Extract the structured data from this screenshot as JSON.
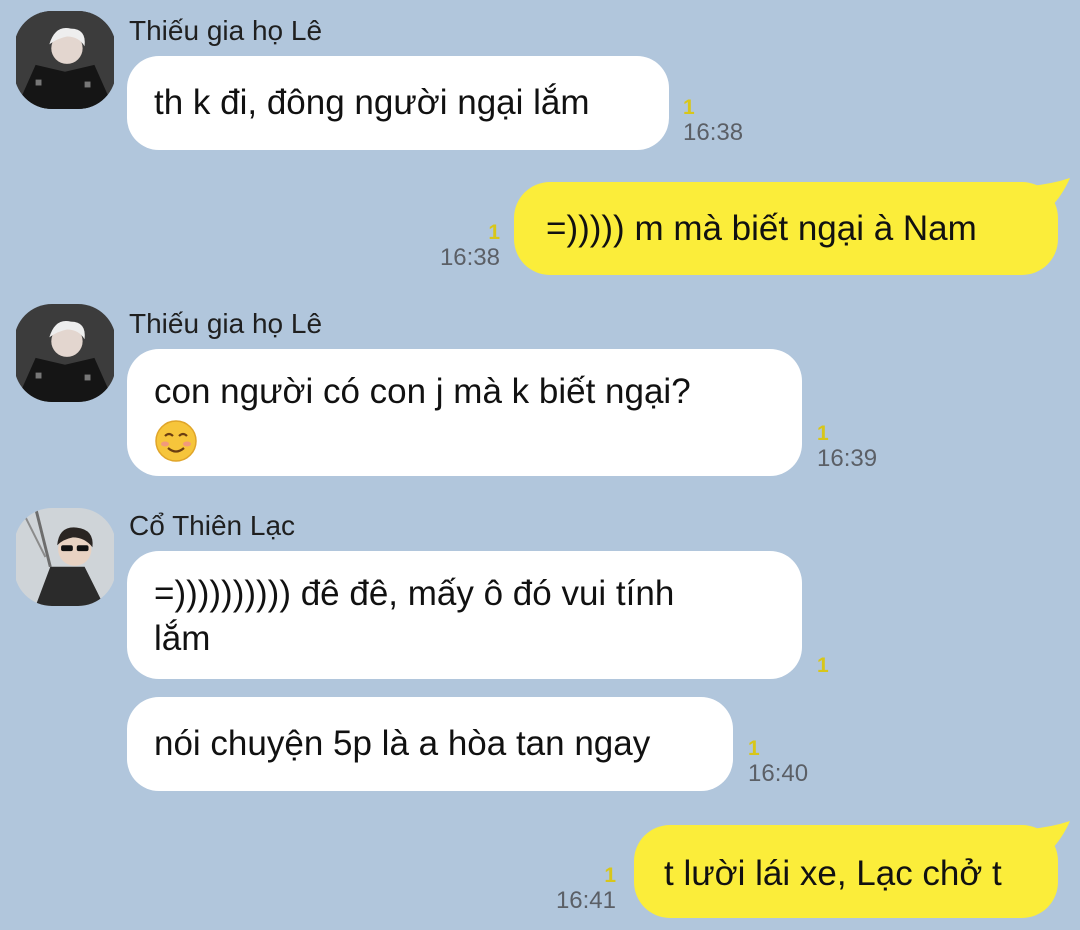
{
  "messages": [
    {
      "sender": "Thiếu gia họ Lê",
      "text": "th k đi, đông người ngại lắm",
      "read": "1",
      "time": "16:38"
    },
    {
      "text": "=))))) m mà biết ngại à Nam",
      "read": "1",
      "time": "16:38"
    },
    {
      "sender": "Thiếu gia họ Lê",
      "text": "con người có con j mà k biết ngại?",
      "emoji": "☺️",
      "read": "1",
      "time": "16:39"
    },
    {
      "sender": "Cổ Thiên Lạc",
      "line1": "=)))))))))) đê đê, mấy ô đó vui tính",
      "line2": "lắm",
      "read": "1"
    },
    {
      "text": "nói chuyện 5p là a hòa tan ngay",
      "read": "1",
      "time": "16:40"
    },
    {
      "text": "t lười lái xe, Lạc chở t",
      "read": "1",
      "time": "16:41"
    }
  ],
  "colors": {
    "background": "#b1c6dc",
    "incoming": "#ffffff",
    "outgoing": "#fbed3a",
    "read": "#d8c61a"
  },
  "icons": {
    "avatar1": "user-photo",
    "avatar2": "user-photo",
    "emoji": "smiling-face"
  }
}
